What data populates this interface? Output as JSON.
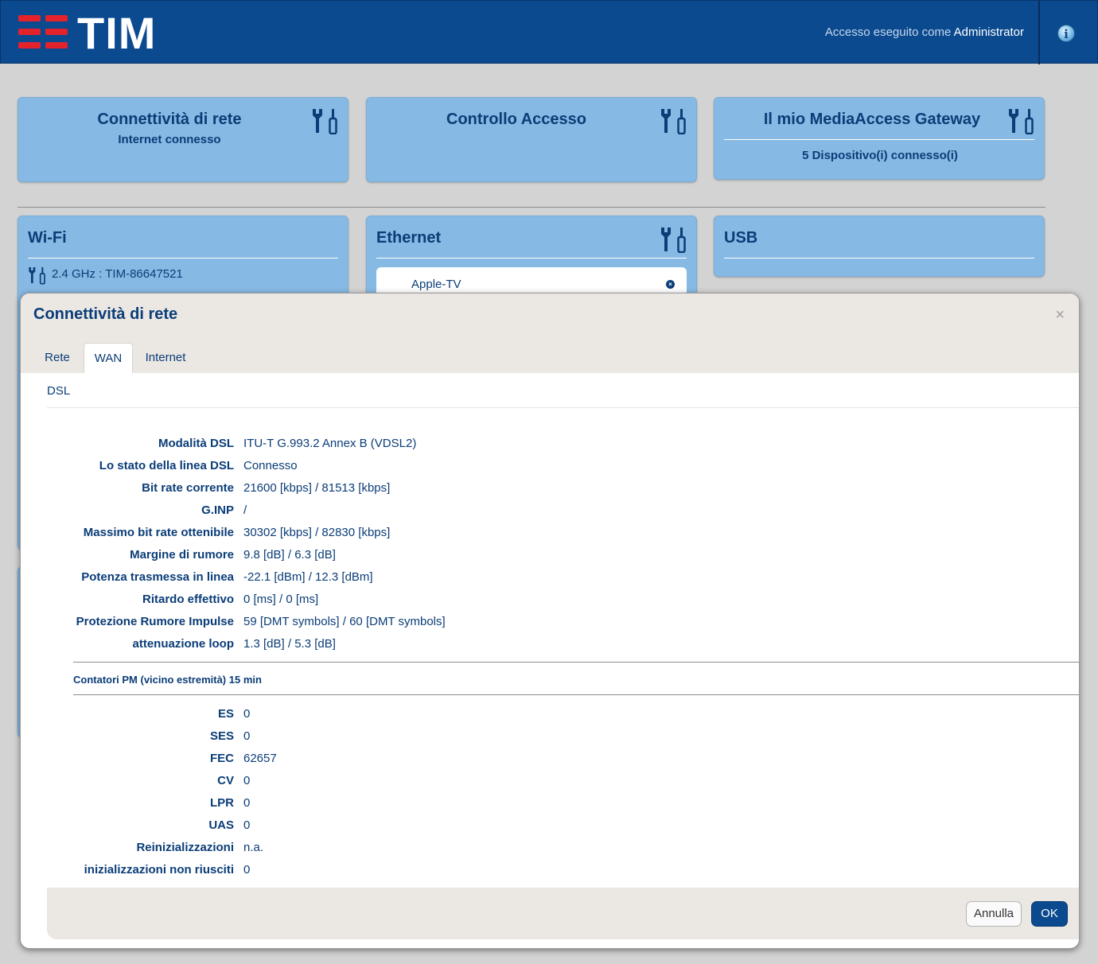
{
  "header": {
    "logo_text": "TIM",
    "login_prefix": "Accesso eseguito come",
    "login_user": "Administrator"
  },
  "cards": {
    "connettivita": {
      "title": "Connettività di rete",
      "subtitle": "Internet connesso"
    },
    "controllo": {
      "title": "Controllo Accesso"
    },
    "gateway": {
      "title": "Il mio MediaAccess Gateway",
      "subtitle": "5 Dispositivo(i) connesso(i)"
    },
    "wifi": {
      "title": "Wi-Fi",
      "network": "2.4 GHz : TIM-86647521"
    },
    "ethernet": {
      "title": "Ethernet",
      "device": "Apple-TV"
    },
    "usb": {
      "title": "USB"
    }
  },
  "modal": {
    "title": "Connettività di rete",
    "close": "×",
    "tabs": [
      {
        "label": "Rete"
      },
      {
        "label": "WAN"
      },
      {
        "label": "Internet"
      }
    ],
    "active_tab": "WAN",
    "section": "DSL",
    "rows": [
      {
        "label": "Modalità DSL",
        "value": "ITU-T G.993.2 Annex B (VDSL2)"
      },
      {
        "label": "Lo stato della linea DSL",
        "value": "Connesso"
      },
      {
        "label": "Bit rate corrente",
        "value": "21600 [kbps] / 81513 [kbps]"
      },
      {
        "label": "G.INP",
        "value": "/"
      },
      {
        "label": "Massimo bit rate ottenibile",
        "value": "30302 [kbps] / 82830 [kbps]"
      },
      {
        "label": "Margine di rumore",
        "value": "9.8 [dB] / 6.3 [dB]"
      },
      {
        "label": "Potenza trasmessa in linea",
        "value": "-22.1 [dBm] / 12.3 [dBm]"
      },
      {
        "label": "Ritardo effettivo",
        "value": "0 [ms] / 0 [ms]"
      },
      {
        "label": "Protezione Rumore Impulse",
        "value": "59 [DMT symbols] / 60 [DMT symbols]"
      },
      {
        "label": "attenuazione loop",
        "value": "1.3 [dB] / 5.3 [dB]"
      }
    ],
    "pm_title": "Contatori PM (vicino estremità) 15 min",
    "pm_rows": [
      {
        "label": "ES",
        "value": "0"
      },
      {
        "label": "SES",
        "value": "0"
      },
      {
        "label": "FEC",
        "value": "62657"
      },
      {
        "label": "CV",
        "value": "0"
      },
      {
        "label": "LPR",
        "value": "0"
      },
      {
        "label": "UAS",
        "value": "0"
      },
      {
        "label": "Reinizializzazioni",
        "value": "n.a."
      },
      {
        "label": "inizializzazioni non riusciti",
        "value": "0"
      }
    ],
    "buttons": {
      "cancel": "Annulla",
      "ok": "OK"
    }
  }
}
